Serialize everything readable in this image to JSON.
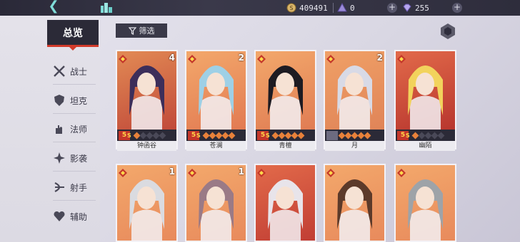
{
  "topbar": {
    "back_icon": "back-arrow-icon",
    "city_icon": "city-icon",
    "gold": "409491",
    "token": "0",
    "gems": "255",
    "plus": "+"
  },
  "sidebar": {
    "overview": "总览",
    "items": [
      {
        "label": "战士",
        "icon": "crossed-swords-icon"
      },
      {
        "label": "坦克",
        "icon": "shield-icon"
      },
      {
        "label": "法师",
        "icon": "hand-magic-icon"
      },
      {
        "label": "影袭",
        "icon": "shuriken-icon"
      },
      {
        "label": "射手",
        "icon": "bow-icon"
      },
      {
        "label": "辅助",
        "icon": "heart-icon"
      }
    ]
  },
  "filter": {
    "label": "筛选"
  },
  "cards": [
    {
      "name": "钟函谷",
      "rank": "5",
      "tier": "4",
      "stars": 1,
      "grade": "S",
      "bg": [
        "#e28a54",
        "#c14a3a"
      ],
      "hair": "#3c2e5a"
    },
    {
      "name": "苍澜",
      "rank": "5",
      "tier": "2",
      "stars": 5,
      "grade": "S",
      "bg": [
        "#f3a86b",
        "#e27a52"
      ],
      "hair": "#9ed0e6"
    },
    {
      "name": "青檀",
      "rank": "5",
      "tier": "",
      "stars": 5,
      "grade": "S",
      "bg": [
        "#f3a86b",
        "#e07c53"
      ],
      "hair": "#1d1b22"
    },
    {
      "name": "月",
      "rank": "",
      "tier": "2",
      "stars": 5,
      "grade": "",
      "bg": [
        "#f0a066",
        "#e08458"
      ],
      "hair": "#d8dae6"
    },
    {
      "name": "幽陌",
      "rank": "5",
      "tier": "",
      "stars": 1,
      "grade": "S",
      "bg": [
        "#e26a4a",
        "#b8362e"
      ],
      "hair": "#f2d35c"
    },
    {
      "name": "",
      "rank": "",
      "tier": "1",
      "stars": 0,
      "grade": "",
      "bg": [
        "#f3a86b",
        "#e88a5c"
      ],
      "hair": "#dadbe0"
    },
    {
      "name": "",
      "rank": "",
      "tier": "1",
      "stars": 0,
      "grade": "",
      "bg": [
        "#f3a86b",
        "#e88a5c"
      ],
      "hair": "#9a7a86"
    },
    {
      "name": "",
      "rank": "",
      "tier": "",
      "stars": 0,
      "grade": "",
      "bg": [
        "#e26a4a",
        "#c13e34"
      ],
      "hair": "#e8e4ea"
    },
    {
      "name": "",
      "rank": "",
      "tier": "",
      "stars": 0,
      "grade": "",
      "bg": [
        "#f3a86b",
        "#e88a5c"
      ],
      "hair": "#5c3a2a"
    },
    {
      "name": "",
      "rank": "",
      "tier": "",
      "stars": 0,
      "grade": "",
      "bg": [
        "#f3a86b",
        "#e88a5c"
      ],
      "hair": "#9ea3a8"
    }
  ]
}
